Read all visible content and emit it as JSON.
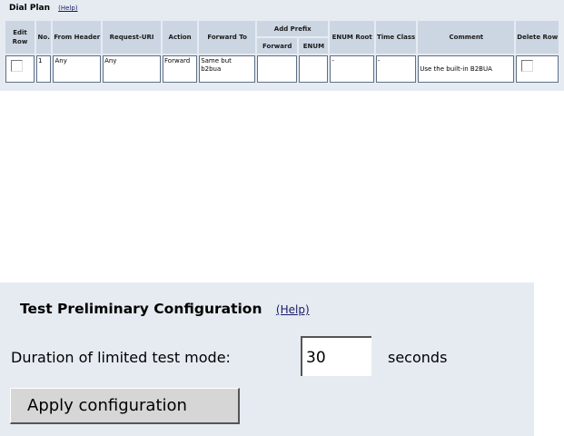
{
  "dial_plan": {
    "title": "Dial Plan",
    "help_link": "(Help)",
    "headers": {
      "edit_row": "Edit Row",
      "no": "No.",
      "from_header": "From Header",
      "request_uri": "Request-URI",
      "action": "Action",
      "forward_to": "Forward To",
      "add_prefix": "Add Prefix",
      "prefix_forward": "Forward",
      "prefix_enum": "ENUM",
      "enum_root": "ENUM Root",
      "time_class": "Time Class",
      "comment": "Comment",
      "delete_row": "Delete Row"
    },
    "rows": [
      {
        "edit_checked": false,
        "no": "1",
        "from_header": "Any",
        "request_uri": "Any",
        "action": "Forward",
        "forward_to": "Same but b2bua",
        "prefix_forward": "",
        "prefix_enum": "",
        "enum_root": "-",
        "time_class": "-",
        "comment": "Use the built-in B2BUA",
        "delete_checked": false
      }
    ]
  },
  "test_config": {
    "title": "Test Preliminary Configuration",
    "help_link": "(Help)",
    "duration_label": "Duration of limited test mode:",
    "duration_value": "30",
    "duration_unit": "seconds",
    "apply_button": "Apply configuration"
  }
}
